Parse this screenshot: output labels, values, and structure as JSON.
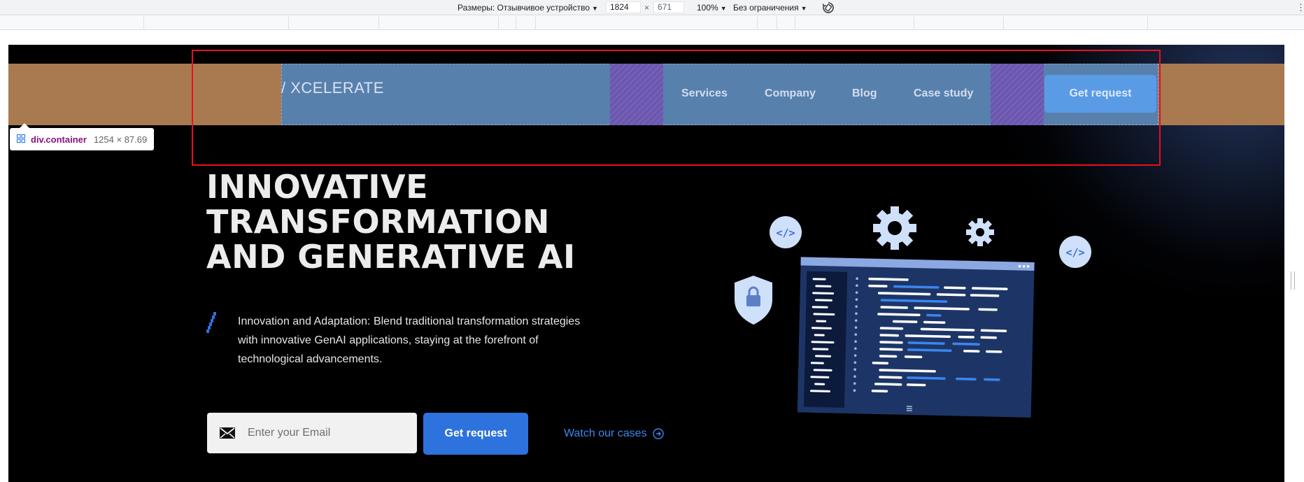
{
  "devtools": {
    "dimensions_label": "Размеры: Отзывчивое устройство",
    "width": "1824",
    "times": "×",
    "height": "671",
    "zoom": "100%",
    "throttle": "Без ограничения",
    "rotate_icon": "rotate-icon",
    "more_icon": "more-vert-icon"
  },
  "inspector_tooltip": {
    "element": "div.container",
    "size": "1254 × 87.69",
    "highlight_colors": {
      "margin": "#a97a4f",
      "content": "#5880ad",
      "gap": "#6a56ad"
    }
  },
  "header": {
    "logo": "/ XCELERATE",
    "nav": [
      "Services",
      "Company",
      "Blog",
      "Case study"
    ],
    "button": "Get request"
  },
  "hero": {
    "title_lines": [
      "INNOVATIVE",
      "TRANSFORMATION",
      "AND GENERATIVE AI"
    ],
    "description": "Innovation and Adaptation: Blend traditional transformation strategies with innovative GenAI applications, staying at the forefront of technological advancements.",
    "email_placeholder": "Enter your Email",
    "cta_button": "Get request",
    "watch_link": "Watch our cases"
  },
  "colors": {
    "background": "#000000",
    "accent_blue": "#2e72dd",
    "link_blue": "#3a86f0",
    "highlight_box": "#e8101e"
  }
}
